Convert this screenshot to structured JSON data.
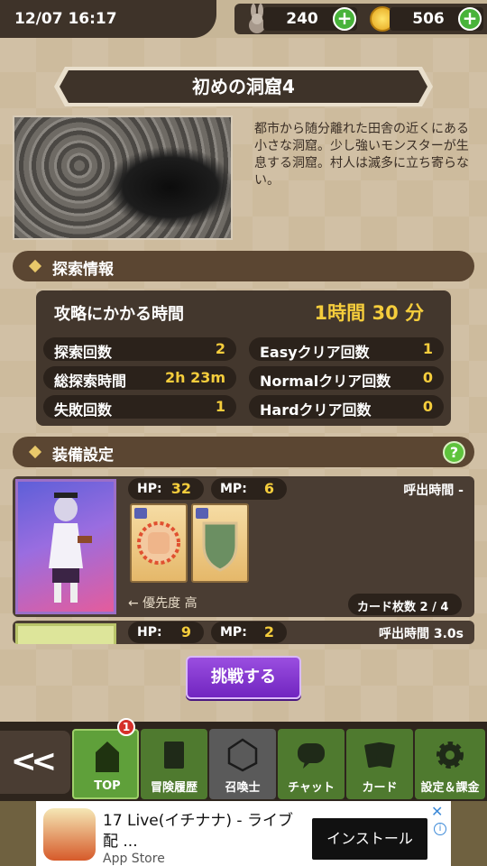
{
  "status_bar": {
    "datetime": "12/07 16:17"
  },
  "resources": {
    "rabbit": "240",
    "gold": "506"
  },
  "location": {
    "title": "初めの洞窟4",
    "description": "都市から随分離れた田舎の近くにある小さな洞窟。少し強いモンスターが生息する洞窟。村人は滅多に立ち寄らない。"
  },
  "explore_section": {
    "header": "探索情報",
    "time_label": "攻略にかかる時間",
    "time_value": "1時間 30 分",
    "stats": [
      {
        "label": "探索回数",
        "value": "2"
      },
      {
        "label": "Easyクリア回数",
        "value": "1"
      },
      {
        "label": "総探索時間",
        "value": "2h 23m"
      },
      {
        "label": "Normalクリア回数",
        "value": "0"
      },
      {
        "label": "失敗回数",
        "value": "1"
      },
      {
        "label": "Hardクリア回数",
        "value": "0"
      }
    ]
  },
  "equip_section": {
    "header": "装備設定",
    "help": "?",
    "slots": [
      {
        "hp_label": "HP:",
        "hp": "32",
        "mp_label": "MP:",
        "mp": "6",
        "call_time": "呼出時間 -",
        "priority": "← 優先度 高",
        "card_count": "カード枚数 2 / 4"
      },
      {
        "hp_label": "HP:",
        "hp": "9",
        "mp_label": "MP:",
        "mp": "2",
        "call_time": "呼出時間 3.0s"
      }
    ]
  },
  "challenge_button": "挑戦する",
  "nav": {
    "back": "<<",
    "badge": "1",
    "items": [
      {
        "label": "TOP",
        "icon": "church-icon"
      },
      {
        "label": "冒険履歴",
        "icon": "book-icon"
      },
      {
        "label": "召喚士",
        "icon": "dice-icon"
      },
      {
        "label": "チャット",
        "icon": "chat-icon"
      },
      {
        "label": "カード",
        "icon": "cards-icon"
      },
      {
        "label": "設定＆課金",
        "icon": "gear-icon"
      }
    ]
  },
  "ad": {
    "title": "17 Live(イチナナ) - ライブ",
    "title2": "配 ...",
    "store": "App Store",
    "install": "インストール"
  },
  "colors": {
    "accent_gold": "#f5cd3c",
    "nav_green": "#4f7a2f",
    "challenge_purple": "#7a30c8"
  }
}
